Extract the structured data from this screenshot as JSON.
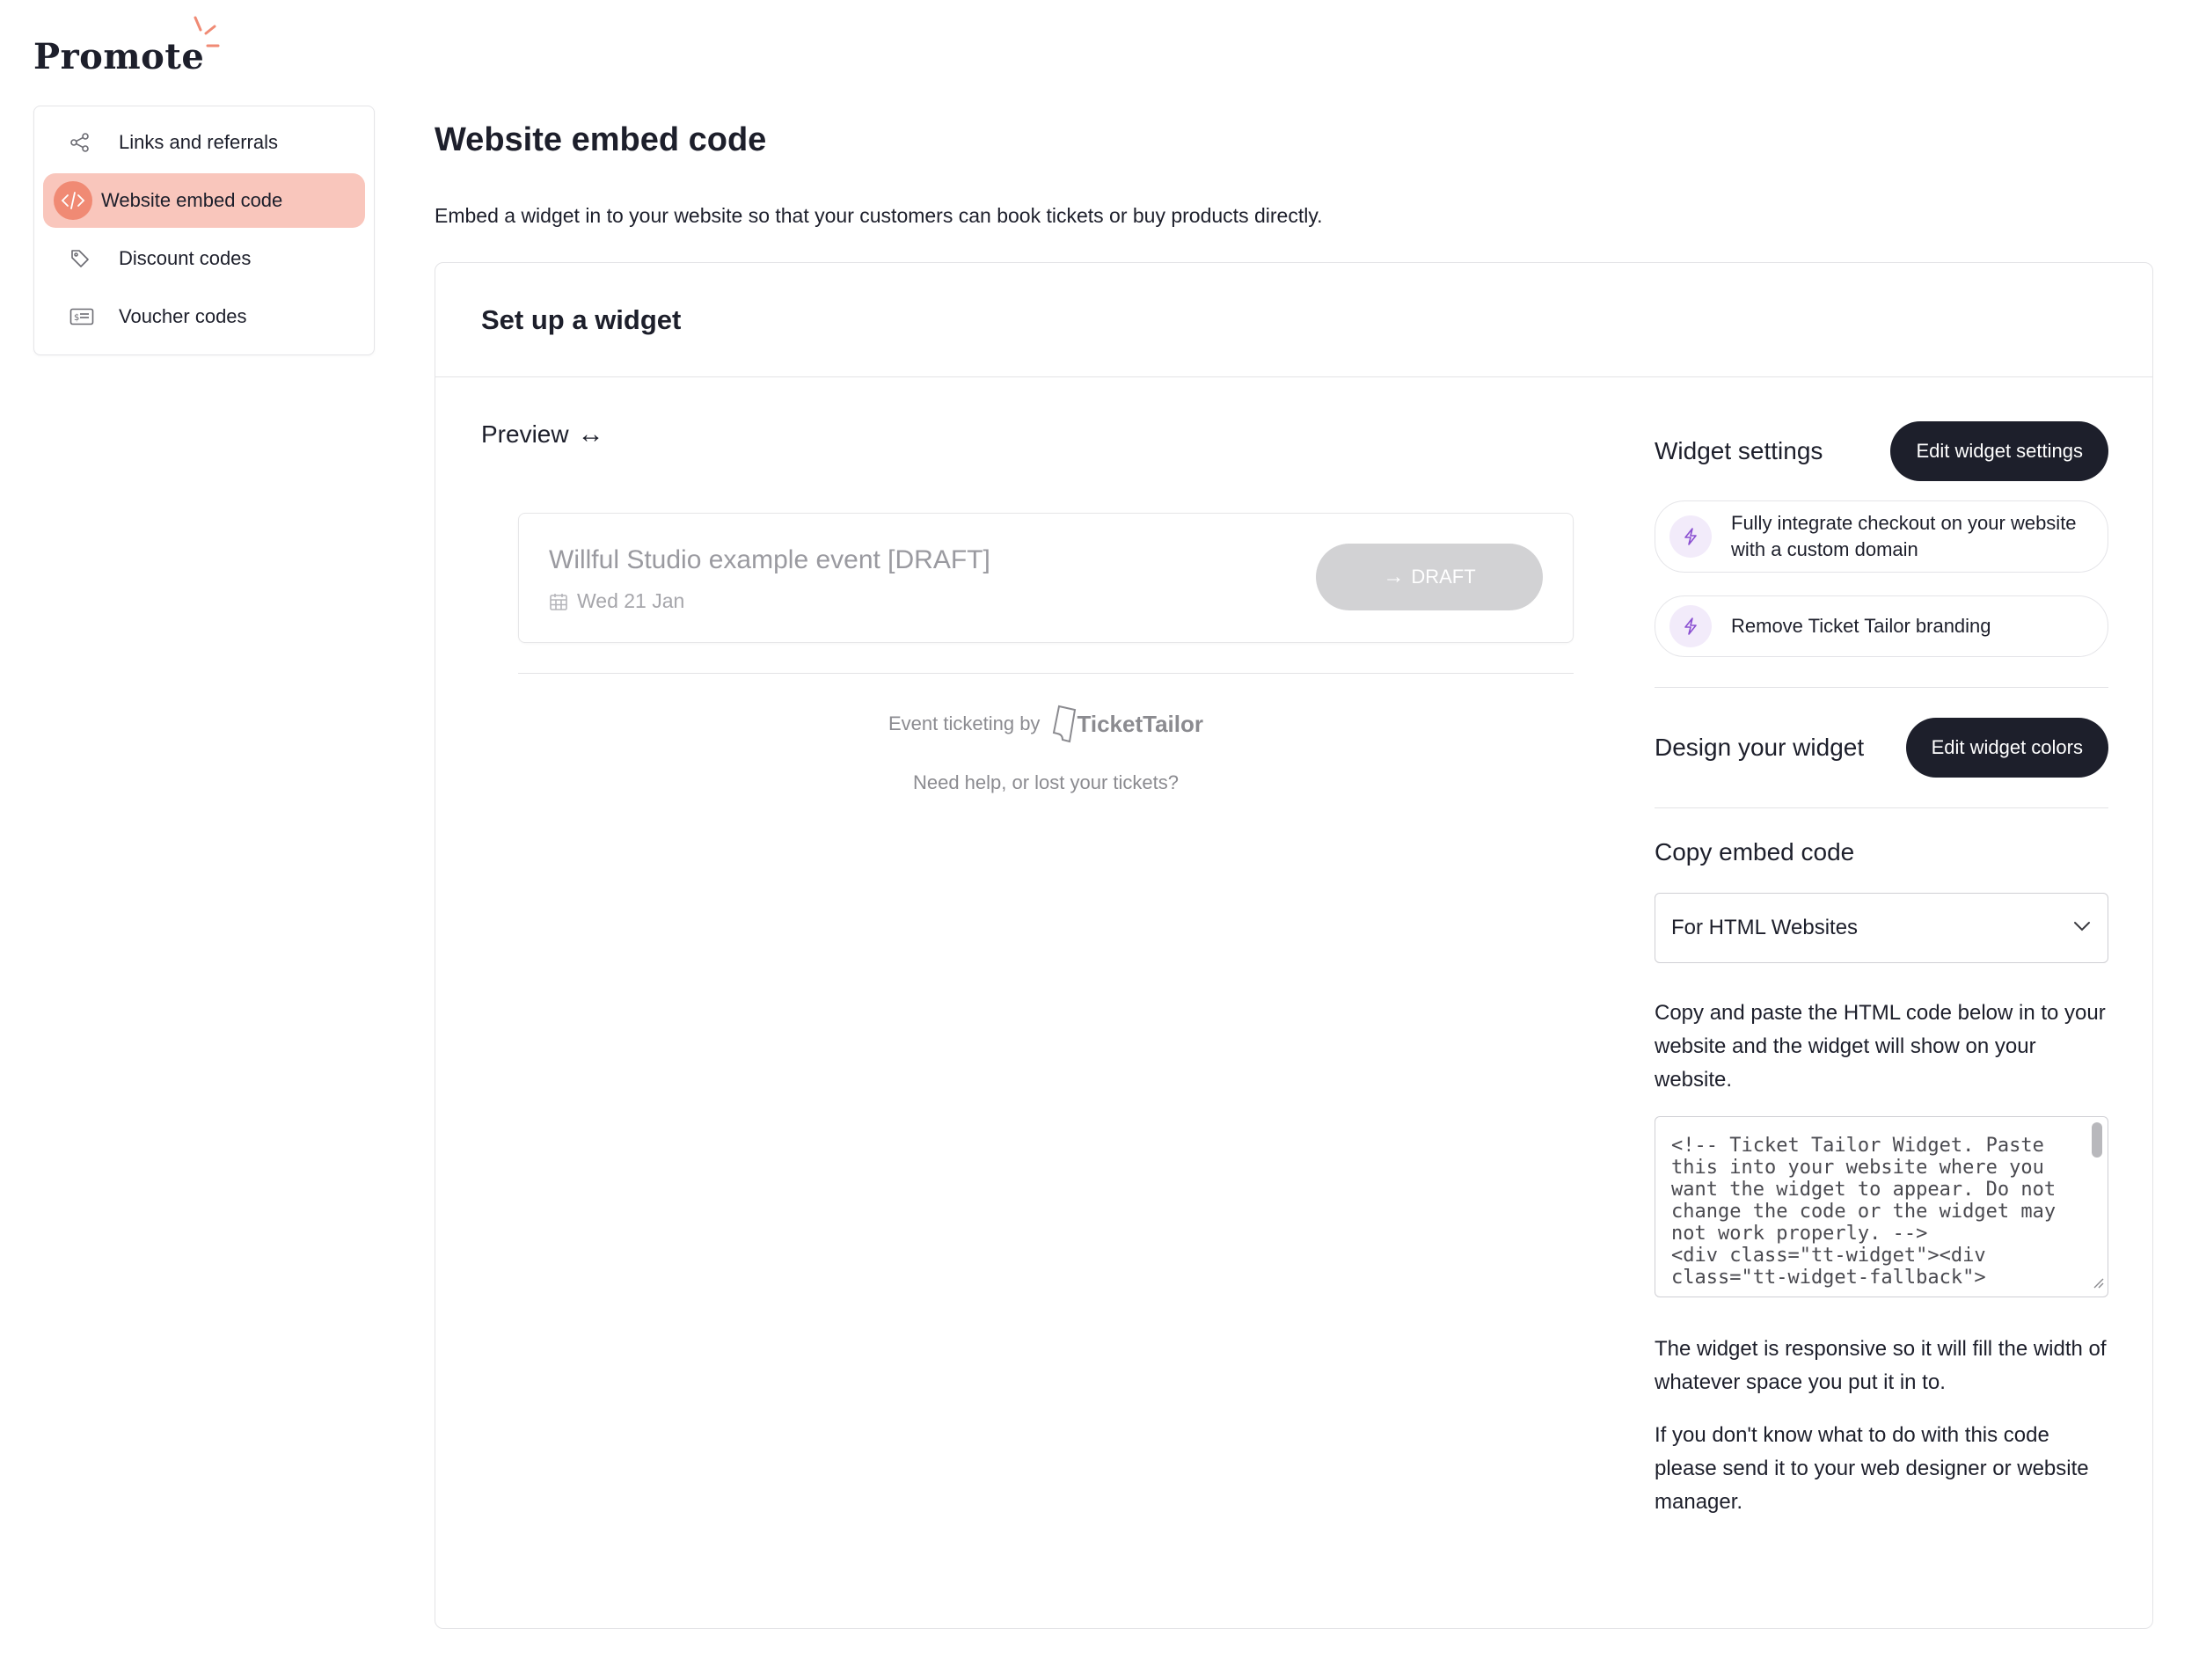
{
  "app": {
    "logo_text": "Promote"
  },
  "sidebar": {
    "items": [
      {
        "label": "Links and referrals",
        "icon": "share-icon",
        "active": false
      },
      {
        "label": "Website embed code",
        "icon": "code-icon",
        "active": true
      },
      {
        "label": "Discount codes",
        "icon": "tag-icon",
        "active": false
      },
      {
        "label": "Voucher codes",
        "icon": "voucher-icon",
        "active": false
      }
    ]
  },
  "main": {
    "title": "Website embed code",
    "subtitle": "Embed a widget in to your website so that your customers can book tickets or buy products directly."
  },
  "card": {
    "title": "Set up a widget",
    "preview": {
      "label": "Preview",
      "arrow": "↔",
      "event_title": "Willful Studio example event [DRAFT]",
      "event_date": "Wed 21 Jan",
      "draft_button": "DRAFT",
      "powered_by": "Event ticketing by",
      "brand": "TicketTailor",
      "help_link": "Need help, or lost your tickets?"
    },
    "widget_settings": {
      "label": "Widget settings",
      "button": "Edit widget settings",
      "upsells": [
        "Fully integrate checkout on your website with a custom domain",
        "Remove Ticket Tailor branding"
      ]
    },
    "design": {
      "label": "Design your widget",
      "button": "Edit widget colors"
    },
    "embed": {
      "label": "Copy embed code",
      "select_value": "For HTML Websites",
      "description": "Copy and paste the HTML code below in to your website and the widget will show on your website.",
      "code": "<!-- Ticket Tailor Widget. Paste this into your website where you want the widget to appear. Do not change the code or the widget may not work properly. -->\n<div class=\"tt-widget\"><div class=\"tt-widget-fallback\">",
      "info_1": "The widget is responsive so it will fill the width of whatever space you put it in to.",
      "info_2": "If you don't know what to do with this code please send it to your web designer or website manager."
    }
  },
  "colors": {
    "accent": "#f08a74",
    "accent_soft": "#f9c6bc",
    "dark": "#1d1f2b",
    "upsell_icon": "#8a4fd1"
  }
}
